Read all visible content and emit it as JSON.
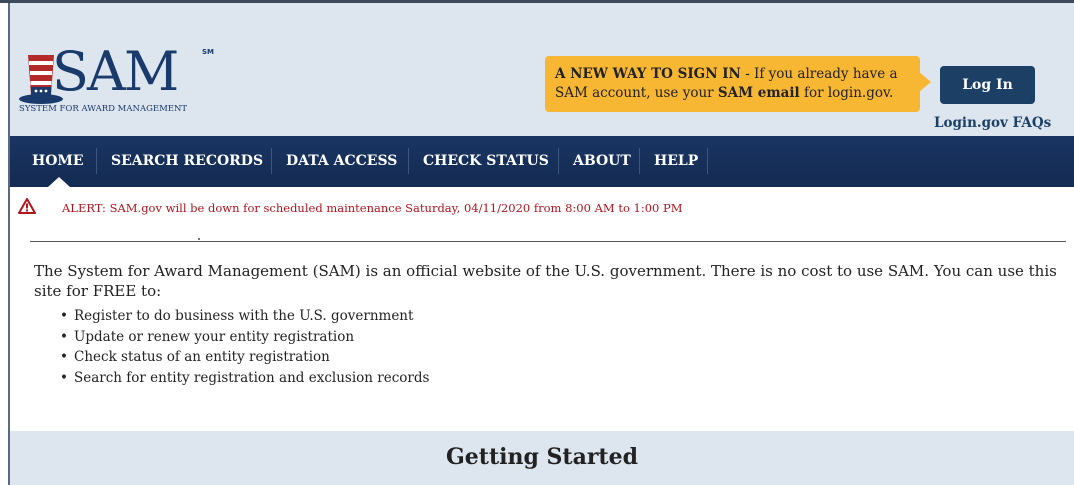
{
  "logo": {
    "name": "SAM",
    "trademark": "SM",
    "subtitle": "SYSTEM FOR AWARD MANAGEMENT"
  },
  "signin_notice": {
    "bold_lead": "A NEW WAY TO SIGN IN",
    "text_part1": " - If you already have a SAM account, use your ",
    "bold_email": "SAM email",
    "text_part2": " for login.gov."
  },
  "login_button": "Log In",
  "faq_link": "Login.gov FAQs",
  "nav": {
    "items": [
      {
        "label": "HOME"
      },
      {
        "label": "SEARCH RECORDS"
      },
      {
        "label": "DATA ACCESS"
      },
      {
        "label": "CHECK STATUS"
      },
      {
        "label": "ABOUT"
      },
      {
        "label": "HELP"
      }
    ]
  },
  "alert": {
    "text": "ALERT: SAM.gov will be down for scheduled maintenance Saturday, 04/11/2020 from 8:00 AM to 1:00 PM"
  },
  "intro": {
    "text": "The System for Award Management (SAM) is an official website of the U.S. government. There is no cost to use SAM. You can use this site for FREE to:",
    "bullets": [
      "Register to do business with the U.S. government",
      "Update or renew your entity registration",
      "Check status of an entity registration",
      "Search for entity registration and exclusion records"
    ]
  },
  "getting_started": {
    "title": "Getting Started"
  },
  "colors": {
    "nav_bg": "#1a3563",
    "header_bg": "#dde5ee",
    "notice_bg": "#f7b733",
    "button_bg": "#1c3f66",
    "alert_red": "#b0141e"
  }
}
